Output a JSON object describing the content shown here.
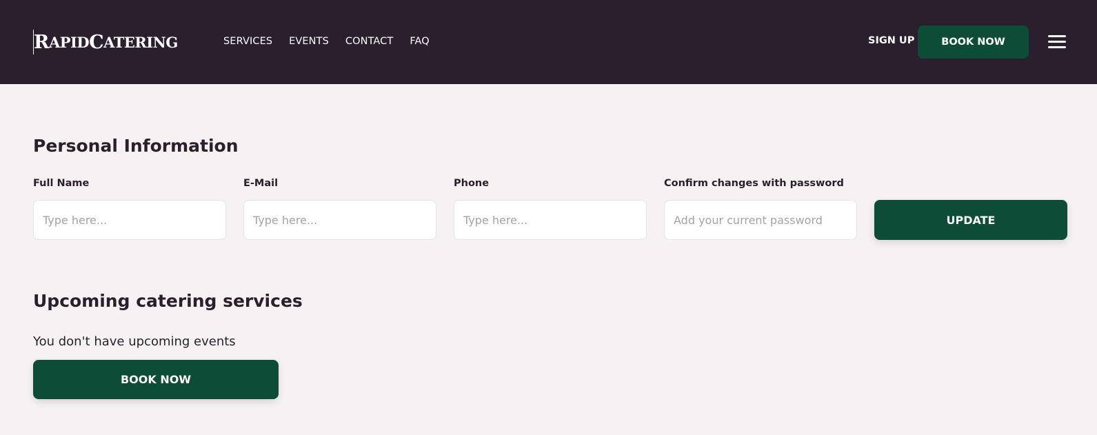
{
  "header": {
    "logo_first": "R",
    "logo_apid": "APID",
    "logo_second": "C",
    "logo_atering": "ATERING",
    "nav": [
      "SERVICES",
      "EVENTS",
      "CONTACT",
      "FAQ"
    ],
    "signup_label": "SIGN UP",
    "book_label": "BOOK NOW",
    "menu_icon": "hamburger-menu-icon"
  },
  "personal": {
    "title": "Personal Information",
    "fields": [
      {
        "label": "Full Name",
        "placeholder": "Type here...",
        "value": ""
      },
      {
        "label": "E-Mail",
        "placeholder": "Type here...",
        "value": ""
      },
      {
        "label": "Phone",
        "placeholder": "Type here...",
        "value": ""
      },
      {
        "label": "Confirm changes with password",
        "placeholder": "Add your current password",
        "value": ""
      }
    ],
    "update_label": "UPDATE"
  },
  "upcoming": {
    "title": "Upcoming catering services",
    "empty_text": "You don't have upcoming events",
    "book_label": "BOOK NOW"
  },
  "colors": {
    "header_bg": "#2a1f2d",
    "page_bg": "#f6f1f2",
    "accent": "#0d4d37"
  }
}
